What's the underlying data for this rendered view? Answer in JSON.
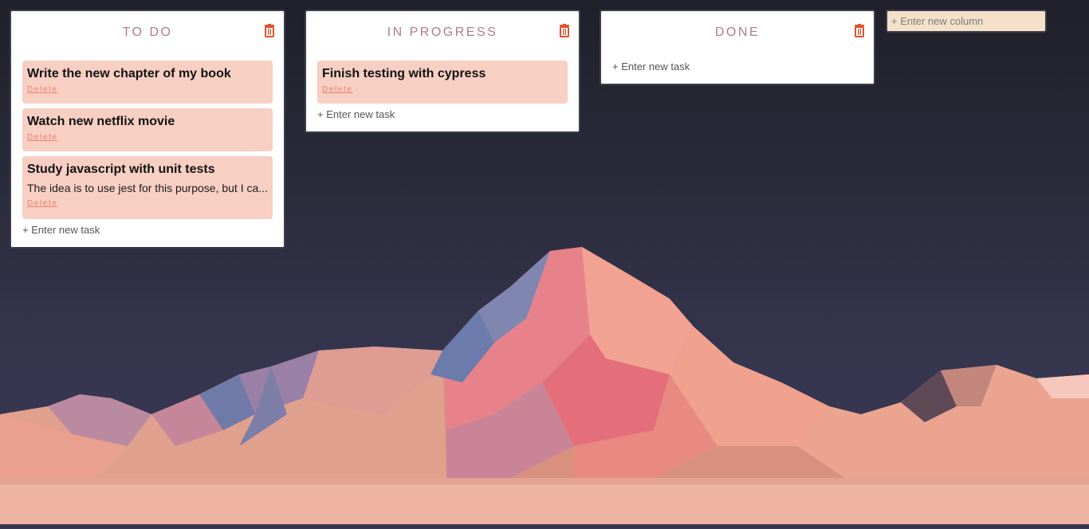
{
  "columns": [
    {
      "title": "TO DO",
      "cards": [
        {
          "title": "Write the new chapter of my book",
          "description": "",
          "delete_label": "Delete"
        },
        {
          "title": "Watch new netflix movie",
          "description": "",
          "delete_label": "Delete"
        },
        {
          "title": "Study javascript with unit tests",
          "description": "The idea is to use jest for this purpose, but I ca...",
          "delete_label": "Delete"
        }
      ],
      "new_task_label": "+ Enter new task"
    },
    {
      "title": "IN PROGRESS",
      "cards": [
        {
          "title": "Finish testing with cypress",
          "description": "",
          "delete_label": "Delete"
        }
      ],
      "new_task_label": "+ Enter new task"
    },
    {
      "title": "DONE",
      "cards": [],
      "new_task_label": "+ Enter new task"
    }
  ],
  "new_column": {
    "placeholder": "+ Enter new column"
  },
  "colors": {
    "card_bg": "#f8cfc3",
    "column_title": "#b07a90",
    "delete_link": "#e6826c",
    "trash_icon": "#e0522a",
    "new_column_bg": "#f5e1c9"
  }
}
